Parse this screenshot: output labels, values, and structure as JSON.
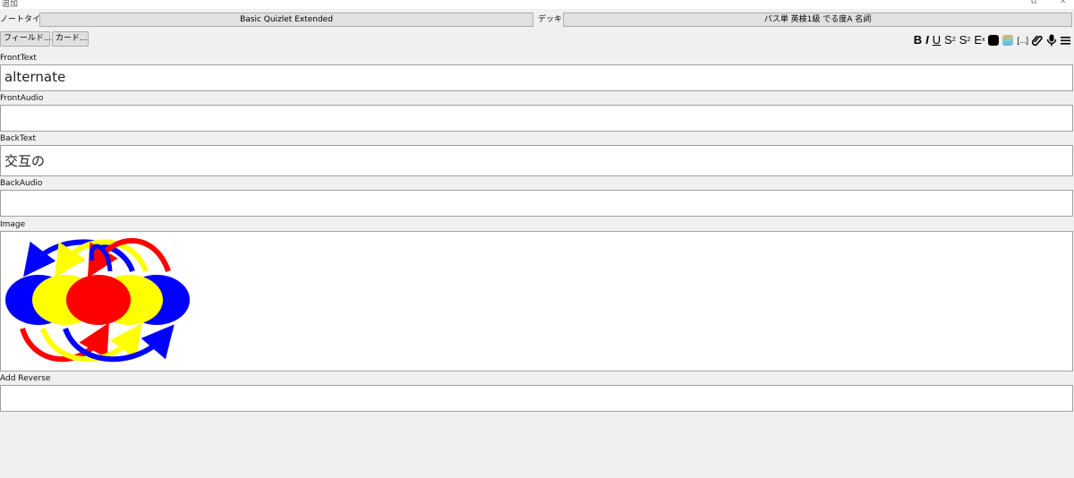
{
  "window": {
    "title": "追加",
    "controls": [
      "⧉",
      "✕"
    ]
  },
  "header": {
    "notetype_label": "ノートタイプ",
    "notetype_value": "Basic Quizlet Extended",
    "deck_label": "デッキ",
    "deck_value": "パス単 英検1級 でる度A 名詞"
  },
  "buttons": {
    "fields": "フィールド...",
    "cards": "カード..."
  },
  "toolbar": {
    "bold": "B",
    "italic": "I",
    "underline": "U",
    "superscript": "S",
    "subscript": "S",
    "clear": "E",
    "text_color": "#000000",
    "highlight_color": "#7ad3c6",
    "cloze": "[...]",
    "attach_icon": "paperclip-icon",
    "record_icon": "microphone-icon",
    "menu_icon": "hamburger-icon"
  },
  "fields": [
    {
      "label": "FrontText",
      "value": "alternate"
    },
    {
      "label": "FrontAudio",
      "value": ""
    },
    {
      "label": "BackText",
      "value": "交互の"
    },
    {
      "label": "BackAudio",
      "value": ""
    },
    {
      "label": "Image",
      "value": ""
    },
    {
      "label": "Add Reverse",
      "value": ""
    }
  ],
  "image": {
    "colors": {
      "blue": "#0000ff",
      "yellow": "#ffff00",
      "red": "#ff0000"
    }
  }
}
